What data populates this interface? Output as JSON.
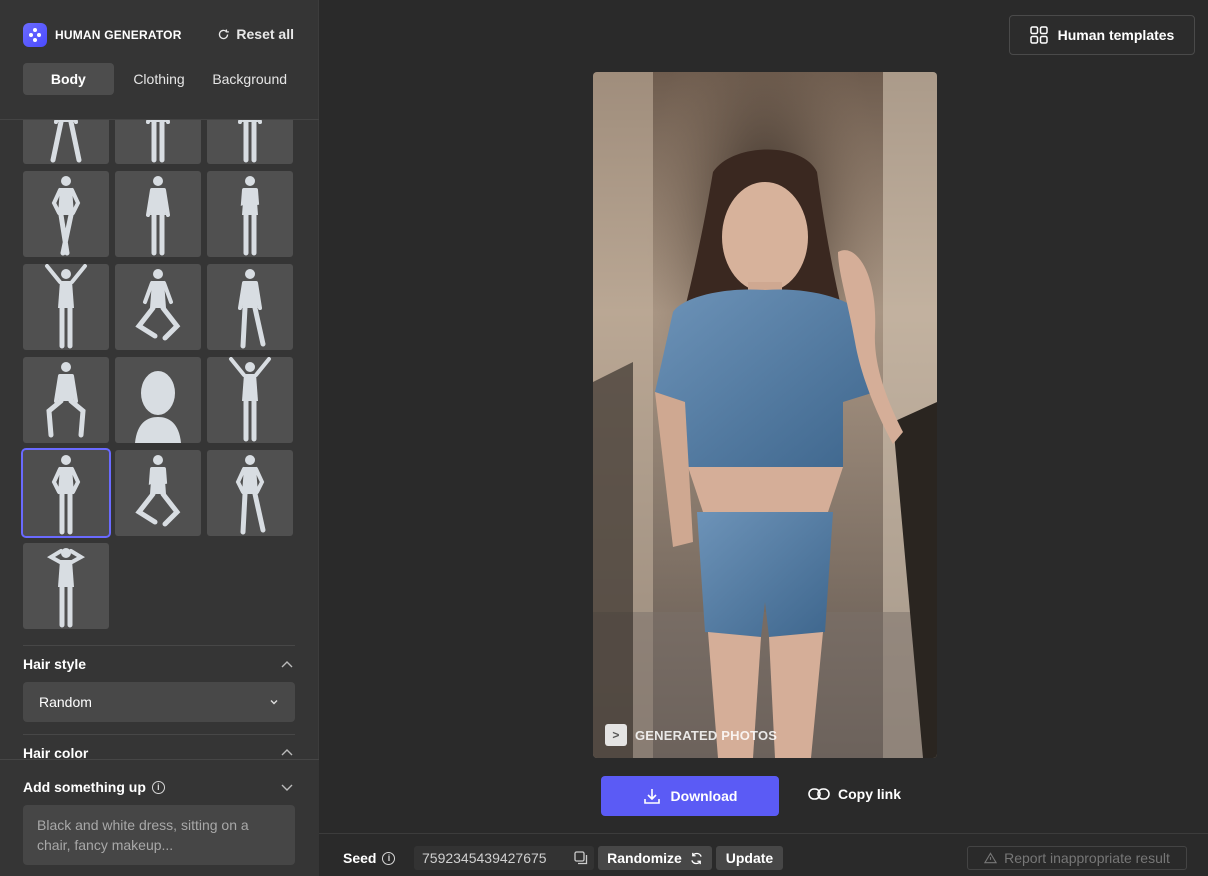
{
  "app": {
    "title": "HUMAN GENERATOR"
  },
  "sidebar": {
    "reset_label": "Reset all",
    "tabs": [
      {
        "label": "Body",
        "active": true
      },
      {
        "label": "Clothing",
        "active": false
      },
      {
        "label": "Background",
        "active": false
      }
    ],
    "poses": {
      "count": 16,
      "selected_index": 12
    },
    "hair_style": {
      "title": "Hair style",
      "value": "Random"
    },
    "hair_color": {
      "title": "Hair color"
    },
    "add_something": {
      "title": "Add something up",
      "placeholder": "Black and white dress, sitting on a chair, fancy makeup..."
    }
  },
  "header": {
    "templates_label": "Human templates"
  },
  "photo": {
    "watermark": "GENERATED PHOTOS",
    "watermark_glyph": ">"
  },
  "actions": {
    "download_label": "Download",
    "copy_link_label": "Copy link"
  },
  "bottom_bar": {
    "seed_label": "Seed",
    "seed_value": "7592345439427675",
    "randomize_label": "Randomize",
    "update_label": "Update",
    "report_label": "Report inappropriate result"
  },
  "colors": {
    "accent": "#5b5bf5",
    "sidebar_bg": "#353535",
    "main_bg": "#2a2a2a"
  }
}
